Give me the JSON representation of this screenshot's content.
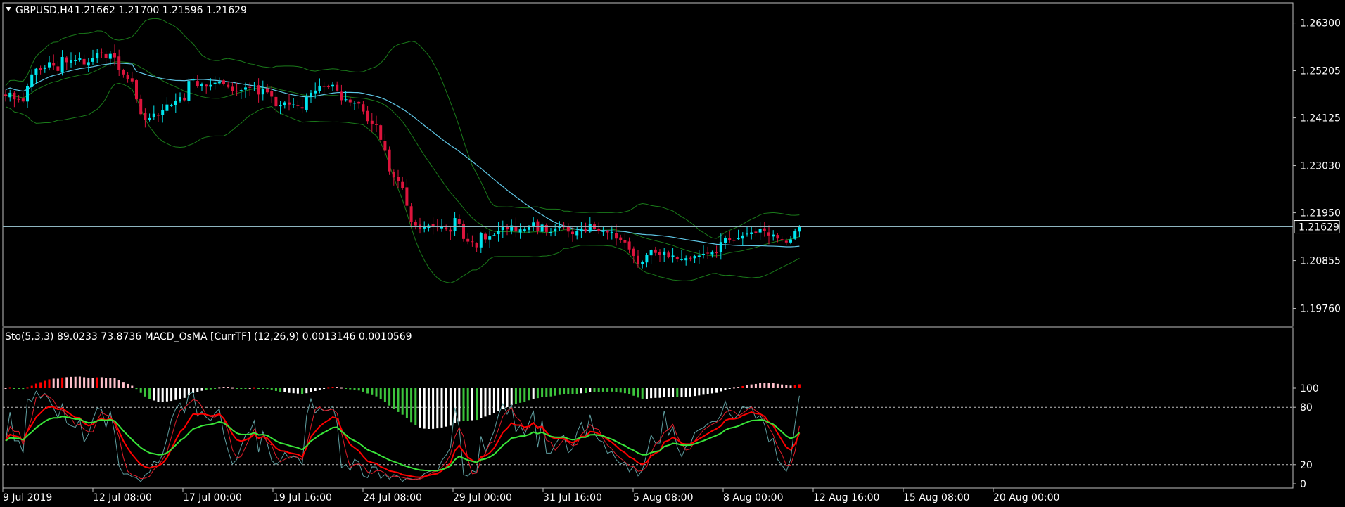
{
  "main_header": {
    "symbol": "GBPUSD,H4",
    "ohlc": "1.21662 1.21700 1.21596 1.21629"
  },
  "sub_header": {
    "text": "Sto(5,3,3) 89.0233 73.8736  MACD_OsMA [CurrTF] (12,26,9) 0.0013146 0.0010569"
  },
  "price_axis": {
    "ticks": [
      "1.26300",
      "1.25205",
      "1.24125",
      "1.23030",
      "1.21950",
      "1.20855",
      "1.19760"
    ],
    "current_label": "1.21629"
  },
  "osc_axis": {
    "ticks": [
      "100",
      "80",
      "20",
      "0"
    ]
  },
  "time_axis": {
    "ticks": [
      "9 Jul 2019",
      "12 Jul 08:00",
      "17 Jul 00:00",
      "19 Jul 16:00",
      "24 Jul 08:00",
      "29 Jul 00:00",
      "31 Jul 16:00",
      "5 Aug 08:00",
      "8 Aug 00:00",
      "12 Aug 16:00",
      "15 Aug 08:00",
      "20 Aug 00:00"
    ]
  },
  "colors": {
    "background": "#000000",
    "bull_candle": "#00e5ee",
    "bear_candle": "#dc143c",
    "ma_line": "#5fc7e6",
    "bands": "#1a7a1a",
    "stoch_main": "#5f9ea0",
    "stoch_signal": "#e11d2a",
    "macd_green": "#3cc43c",
    "macd_red": "#ff0000",
    "macd_white": "#ffffff",
    "macd_pink": "#ffc0cb",
    "ema_fast": "#ff0000",
    "ema_slow": "#39e639",
    "axis": "#c0c0c0"
  },
  "chart_data": [
    {
      "type": "candlestick",
      "title": "GBPUSD,H4",
      "ylim": [
        1.1935,
        1.2676
      ],
      "current_price": 1.21629,
      "x_range": [
        "2019-07-09",
        "2019-08-21"
      ],
      "closes": [
        1.2462,
        1.247,
        1.2455,
        1.2455,
        1.245,
        1.2485,
        1.2512,
        1.2525,
        1.2522,
        1.2528,
        1.254,
        1.2532,
        1.252,
        1.2552,
        1.254,
        1.2545,
        1.2544,
        1.2549,
        1.2535,
        1.254,
        1.2549,
        1.256,
        1.256,
        1.255,
        1.2559,
        1.2551,
        1.2522,
        1.2512,
        1.2502,
        1.2496,
        1.2455,
        1.2421,
        1.2408,
        1.2412,
        1.2422,
        1.2418,
        1.243,
        1.2443,
        1.2441,
        1.2452,
        1.246,
        1.2453,
        1.2497,
        1.25,
        1.2485,
        1.2489,
        1.2484,
        1.2488,
        1.2493,
        1.2496,
        1.249,
        1.2483,
        1.2474,
        1.2474,
        1.2476,
        1.2482,
        1.2482,
        1.2486,
        1.2466,
        1.2478,
        1.2471,
        1.2461,
        1.2439,
        1.2441,
        1.2448,
        1.2443,
        1.2443,
        1.244,
        1.2434,
        1.246,
        1.247,
        1.2475,
        1.2486,
        1.2484,
        1.2484,
        1.2488,
        1.2475,
        1.2453,
        1.2455,
        1.2448,
        1.2447,
        1.2445,
        1.2427,
        1.2405,
        1.2399,
        1.2396,
        1.2362,
        1.2337,
        1.229,
        1.2276,
        1.2267,
        1.2252,
        1.2211,
        1.2174,
        1.2166,
        1.2159,
        1.2163,
        1.2166,
        1.2164,
        1.2162,
        1.2163,
        1.2157,
        1.2152,
        1.2183,
        1.217,
        1.2135,
        1.2129,
        1.2128,
        1.2116,
        1.2149,
        1.2134,
        1.2141,
        1.2144,
        1.2154,
        1.2165,
        1.2157,
        1.2166,
        1.2152,
        1.2157,
        1.2157,
        1.2164,
        1.2173,
        1.2154,
        1.2168,
        1.2151,
        1.2151,
        1.2159,
        1.2162,
        1.2163,
        1.2152,
        1.2146,
        1.2154,
        1.2159,
        1.2152,
        1.2169,
        1.2158,
        1.2154,
        1.2153,
        1.215,
        1.2151,
        1.2136,
        1.2133,
        1.2127,
        1.2111,
        1.2096,
        1.2077,
        1.2082,
        1.2099,
        1.211,
        1.2103,
        1.2098,
        1.2106,
        1.2093,
        1.2097,
        1.2088,
        1.2089,
        1.2091,
        1.2091,
        1.2096,
        1.2097,
        1.2101,
        1.2103,
        1.2104,
        1.2104,
        1.2128,
        1.2138,
        1.2133,
        1.2132,
        1.2137,
        1.2143,
        1.2147,
        1.215,
        1.2148,
        1.2158,
        1.2153,
        1.2143,
        1.2145,
        1.2136,
        1.2133,
        1.2127,
        1.2134,
        1.2154,
        1.2163
      ],
      "overlays": [
        "moving average",
        "bollinger bands"
      ]
    },
    {
      "type": "line",
      "title": "Sto(5,3,3) + MACD_OsMA [CurrTF] (12,26,9)",
      "ylim": [
        0,
        100
      ],
      "levels": [
        20,
        80
      ],
      "series": [
        {
          "name": "Sto(5,3,3)",
          "last": 89.0233
        },
        {
          "name": "Sto(5,3,3) signal",
          "last": 73.8736
        },
        {
          "name": "MACD_OsMA [CurrTF] (12,26,9)",
          "last": 0.0013146
        },
        {
          "name": "MACD_OsMA [CurrTF] (12,26,9) signal",
          "last": 0.0010569
        }
      ]
    }
  ]
}
